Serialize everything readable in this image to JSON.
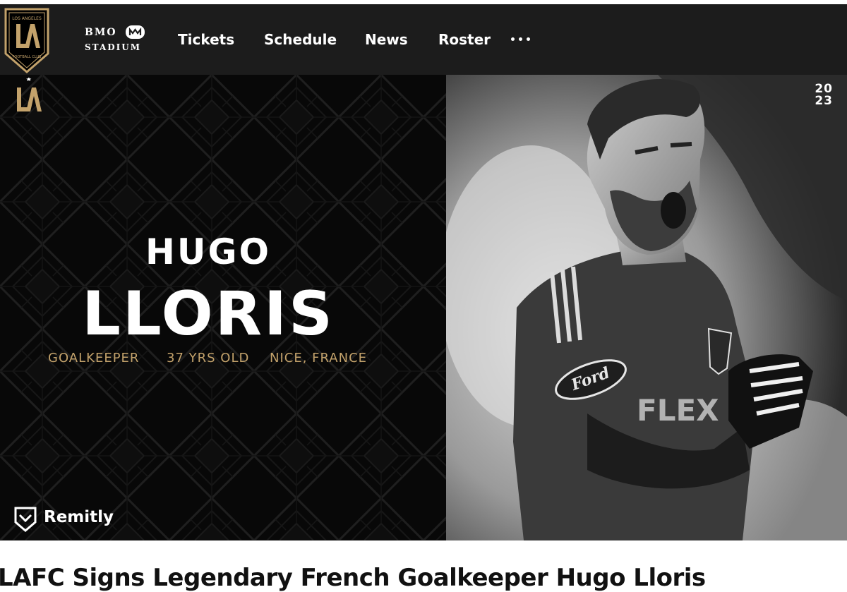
{
  "header": {
    "crest": "lafc-crest-logo",
    "stadium": {
      "line1": "BMO",
      "line2": "STADIUM",
      "icon": "bmo-m-icon"
    },
    "nav": [
      {
        "label": "Tickets"
      },
      {
        "label": "Schedule"
      },
      {
        "label": "News"
      },
      {
        "label": "Roster"
      }
    ],
    "more_icon": "more-dots-icon"
  },
  "hero": {
    "first_name": "HUGO",
    "last_name": "LLORIS",
    "position": "GOALKEEPER",
    "age": "37 YRS OLD",
    "hometown": "NICE, FRANCE",
    "sponsor": "Remitly",
    "year_top": "20",
    "year_bottom": "23",
    "photo": "player-celebration-photo"
  },
  "article": {
    "headline": "LAFC Signs Legendary French Goalkeeper Hugo Lloris"
  },
  "colors": {
    "navbar": "#1c1c1c",
    "gold": "#c3a26b",
    "hero_bg": "#080808"
  }
}
